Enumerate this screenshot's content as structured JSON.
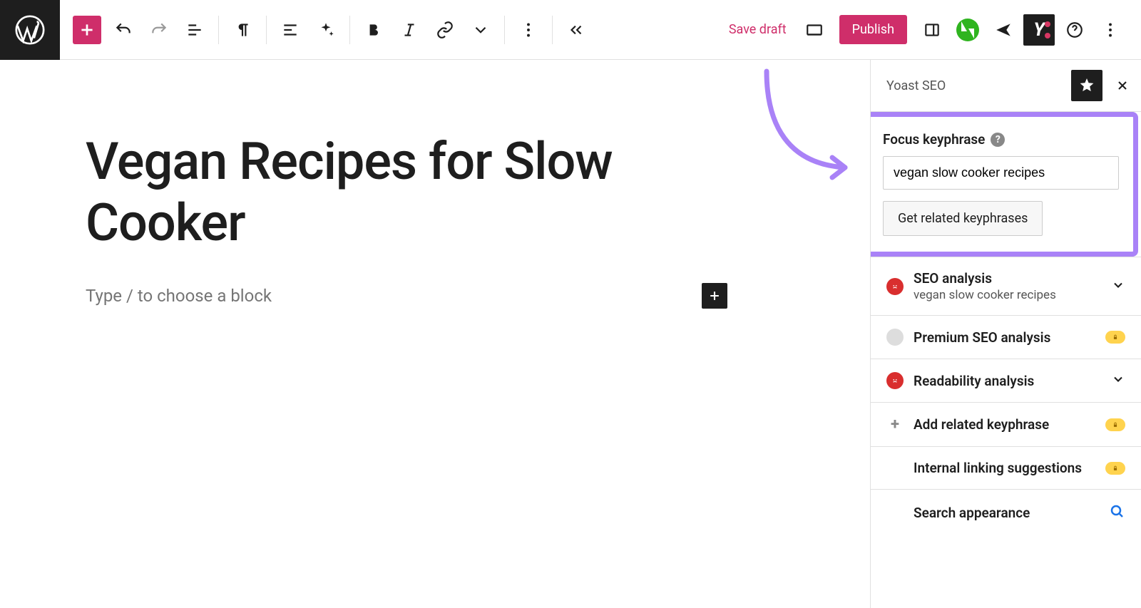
{
  "post": {
    "title": "Vegan Recipes for Slow Cooker",
    "placeholder": "Type / to choose a block"
  },
  "toolbar": {
    "save_draft": "Save draft",
    "publish": "Publish"
  },
  "sidebar": {
    "title": "Yoast SEO",
    "focus": {
      "label": "Focus keyphrase",
      "value": "vegan slow cooker recipes",
      "related_button": "Get related keyphrases"
    },
    "panels": [
      {
        "name": "SEO analysis",
        "sub": "vegan slow cooker recipes",
        "status": "bad",
        "expandable": true
      },
      {
        "name": "Premium SEO analysis",
        "status": "gray",
        "locked": true
      },
      {
        "name": "Readability analysis",
        "status": "bad",
        "expandable": true
      },
      {
        "name": "Add related keyphrase",
        "plus": true,
        "locked": true
      },
      {
        "name": "Internal linking suggestions",
        "locked": true
      },
      {
        "name": "Search appearance",
        "search": true
      }
    ]
  }
}
